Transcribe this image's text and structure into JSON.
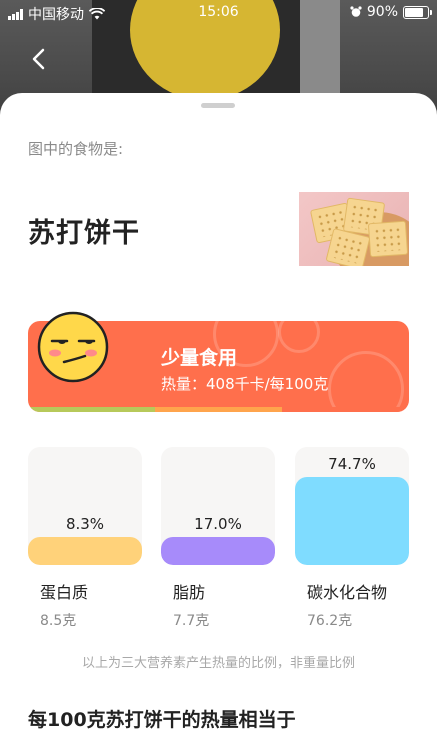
{
  "status": {
    "carrier": "中国移动",
    "time": "15:06",
    "battery": "90%",
    "battery_level": 0.9
  },
  "sheet": {
    "prompt": "图中的食物是:",
    "food_name": "苏打饼干",
    "food_image_icon": "soda-cracker-photo"
  },
  "advice": {
    "level": "少量食用",
    "calorie_text": "热量：408千卡/每100克",
    "face_icon": "smirk-face-icon",
    "color": "#ff6f4c"
  },
  "macros": [
    {
      "name": "蛋白质",
      "percent": "8.3%",
      "amount": "8.5克",
      "ratio": 0.083,
      "color": "#ffd27a"
    },
    {
      "name": "脂肪",
      "percent": "17.0%",
      "amount": "7.7克",
      "ratio": 0.17,
      "color": "#a78bfa"
    },
    {
      "name": "碳水化合物",
      "percent": "74.7%",
      "amount": "76.2克",
      "ratio": 0.747,
      "color": "#7fdcff"
    }
  ],
  "note": "以上为三大营养素产生热量的比例，非重量比例",
  "section_title": "每100克苏打饼干的热量相当于"
}
